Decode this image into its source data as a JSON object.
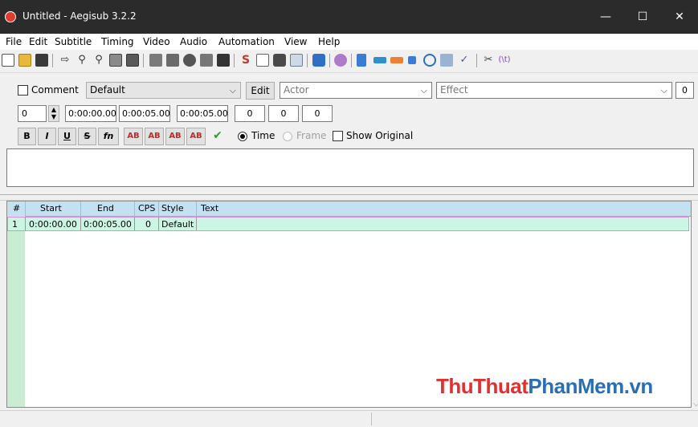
{
  "window": {
    "title": "Untitled - Aegisub 3.2.2",
    "minimize_glyph": "—",
    "maximize_glyph": "☐",
    "close_glyph": "✕"
  },
  "menu": [
    "File",
    "Edit",
    "Subtitle",
    "Timing",
    "Video",
    "Audio",
    "Automation",
    "View",
    "Help"
  ],
  "toolbar_icons": [
    "new-file-icon",
    "open-folder-icon",
    "save-icon",
    "jump-video-icon",
    "zoom-in-icon",
    "zoom-out-icon",
    "open-video-icon",
    "close-video-icon",
    "open-audio-icon",
    "close-audio-icon",
    "jump-to-start-icon",
    "jump-to-end-icon",
    "styles-manager-icon",
    "properties-icon",
    "attachments-icon",
    "fonts-collector-icon",
    "automation-icon",
    "kanji-timer-icon",
    "translation-assistant-icon",
    "resample-icon",
    "timing-postprocessor-icon",
    "shift-times-icon",
    "styling-assistant-icon",
    "spell-checker-icon",
    "options-icon",
    "hotkeys-icon"
  ],
  "edit_box": {
    "comment_label": "Comment",
    "style_value": "Default",
    "edit_button": "Edit",
    "actor_placeholder": "Actor",
    "effect_placeholder": "Effect",
    "margin_value": "0",
    "layer_value": "0",
    "start_time": "0:00:00.00",
    "end_time": "0:00:05.00",
    "duration": "0:00:05.00",
    "margin_left": "0",
    "margin_right": "0",
    "margin_vert": "0",
    "format_buttons": [
      "B",
      "I",
      "U",
      "S",
      "fn",
      "AB",
      "AB",
      "AB",
      "AB"
    ],
    "commit_glyph": "✔",
    "time_label": "Time",
    "frame_label": "Frame",
    "show_original_label": "Show Original"
  },
  "grid": {
    "headers": [
      "#",
      "Start",
      "End",
      "CPS",
      "Style",
      "Text"
    ],
    "rows": [
      {
        "num": "1",
        "start": "0:00:00.00",
        "end": "0:00:05.00",
        "cps": "0",
        "style": "Default",
        "text": ""
      }
    ]
  },
  "watermark": {
    "part1": "ThuThuat",
    "part2": "PhanMem",
    "part3": ".vn"
  },
  "colors": {
    "titlebar": "#2b2b2b",
    "grid_header": "#c4e1f2",
    "active_row": "#ccf6e4",
    "active_row_border": "#e38ad9",
    "left_column": "#c9ecd3",
    "watermark_red": "#e0312f",
    "watermark_blue": "#2a6fb5"
  }
}
